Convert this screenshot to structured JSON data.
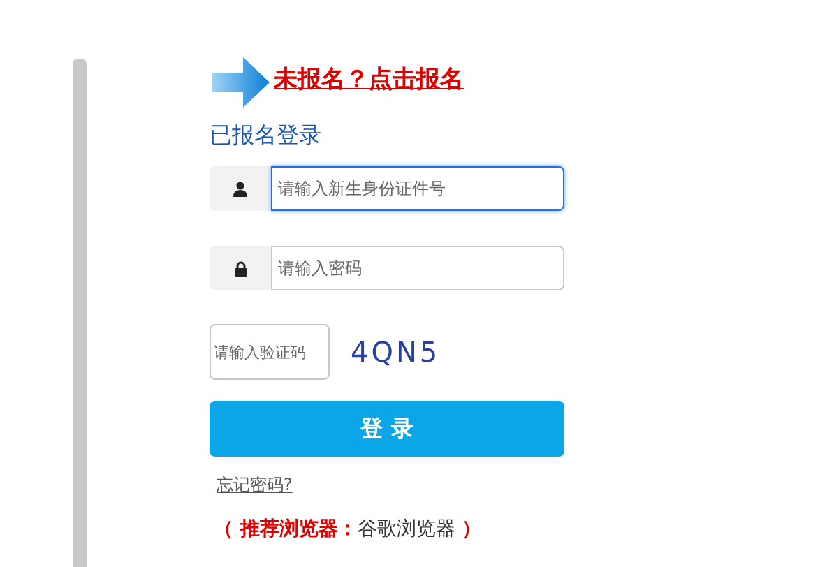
{
  "register_link": "未报名？点击报名",
  "heading": "已报名登录",
  "fields": [
    {
      "kind": "user",
      "placeholder": "请输入新生身份证件号",
      "focused": true
    },
    {
      "kind": "lock",
      "placeholder": "请输入密码",
      "focused": false
    }
  ],
  "captcha": {
    "placeholder": "请输入验证码",
    "code": "4QN5"
  },
  "login_button": "登 录",
  "forgot_link": "忘记密码?",
  "browser_note": {
    "open": "（ 推荐浏览器：",
    "value": "谷歌浏览器",
    "close": " ）"
  }
}
